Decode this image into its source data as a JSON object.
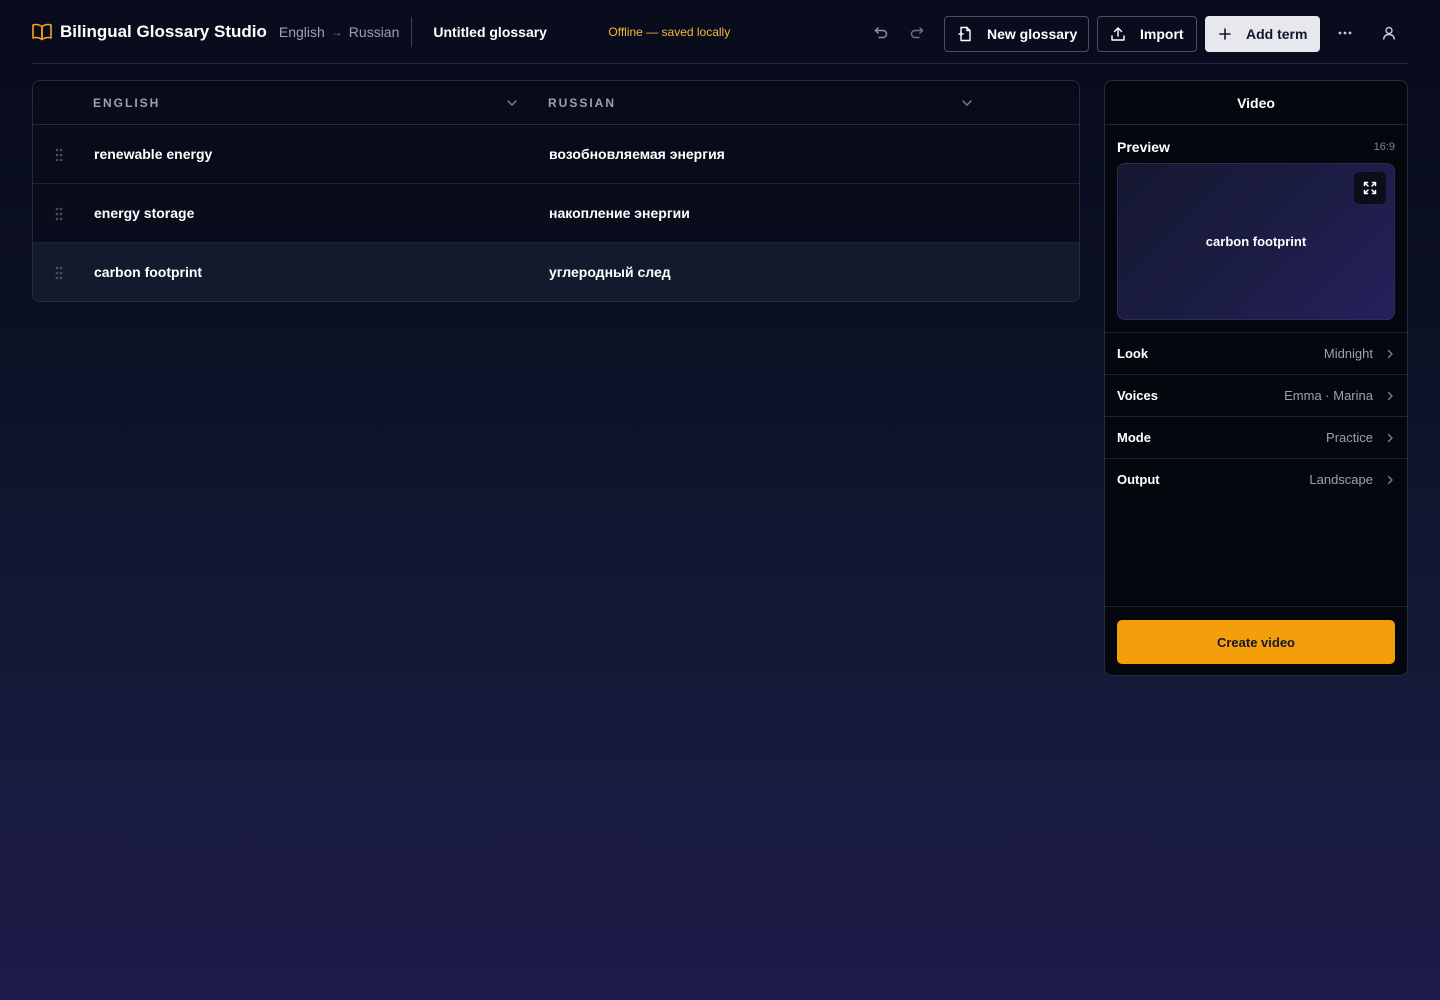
{
  "header": {
    "app_title": "Bilingual Glossary Studio",
    "source_lang": "English",
    "target_lang": "Russian",
    "arrow": "→",
    "doc_title": "Untitled glossary",
    "status": "Offline — saved locally",
    "new_glossary_label": "New glossary",
    "import_label": "Import",
    "add_term_label": "Add term",
    "more_glyph": "···"
  },
  "table": {
    "columns": [
      "ENGLISH",
      "RUSSIAN"
    ],
    "rows": [
      {
        "en": "renewable energy",
        "ru": "возобновляемая энергия"
      },
      {
        "en": "energy storage",
        "ru": "накопление энергии"
      },
      {
        "en": "carbon footprint",
        "ru": "углеродный след"
      }
    ],
    "selected_index": 2
  },
  "video": {
    "title": "Video",
    "preview_label": "Preview",
    "aspect": "16:9",
    "preview_term": "carbon footprint",
    "settings": [
      {
        "label": "Look",
        "value": "Midnight"
      },
      {
        "label": "Voices",
        "value": "Emma · Marina"
      },
      {
        "label": "Mode",
        "value": "Practice"
      },
      {
        "label": "Output",
        "value": "Landscape"
      }
    ],
    "create_label": "Create video"
  },
  "colors": {
    "accent": "#f59e0b",
    "status": "#f5b83d",
    "background_top": "#080b1c",
    "background_bottom": "#1d1b4a"
  },
  "icons": {
    "logo": "book-open-icon",
    "undo": "undo-icon",
    "redo": "redo-icon",
    "new_glossary": "file-plus-icon",
    "import": "upload-icon",
    "add_term": "plus-icon",
    "more": "more-horizontal-icon",
    "user": "user-icon",
    "drag": "drag-handle-icon",
    "fullscreen": "fullscreen-icon",
    "chevron": "chevron-right-icon"
  }
}
